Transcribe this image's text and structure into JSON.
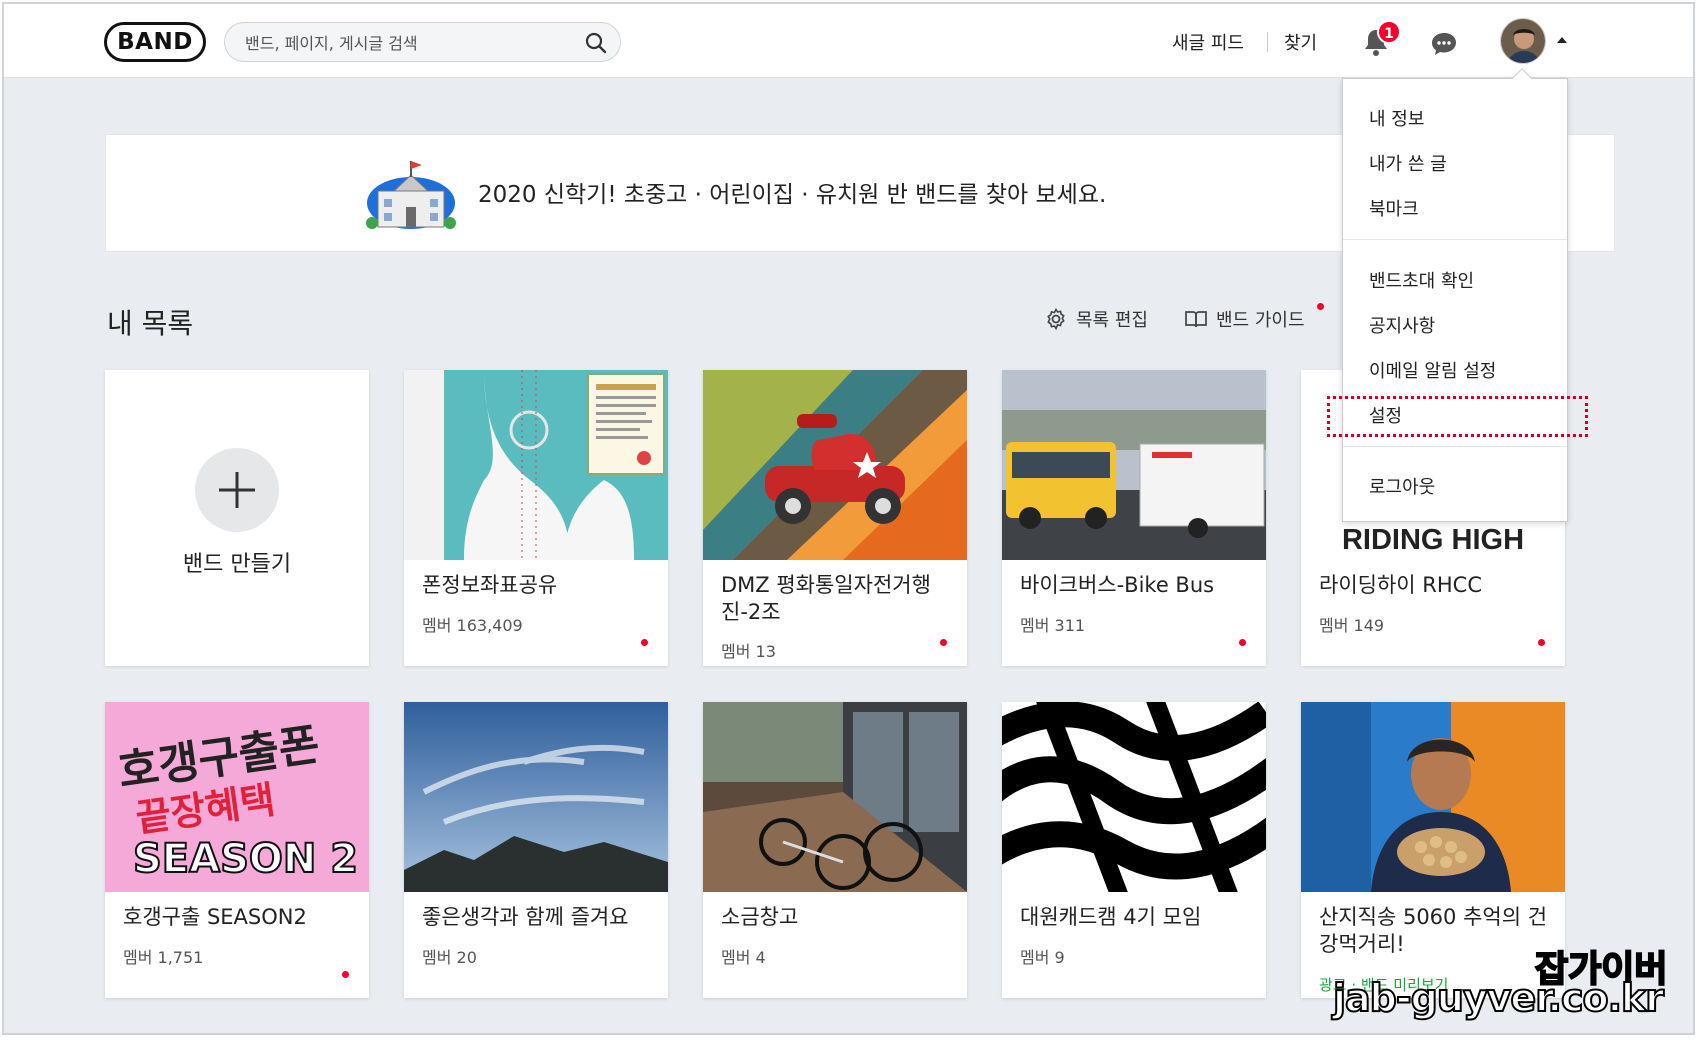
{
  "header": {
    "logo": "BAND",
    "search_placeholder": "밴드, 페이지, 게시글 검색",
    "new_feed": "새글 피드",
    "find": "찾기",
    "notification_count": "1"
  },
  "banner": {
    "text": "2020 신학기! 초중고 · 어린이집 · 유치원 반 밴드를 찾아 보세요."
  },
  "section": {
    "title": "내 목록",
    "edit_list": "목록 편집",
    "band_guide": "밴드 가이드"
  },
  "create_band": "밴드 만들기",
  "bands_row1": [
    {
      "name": "폰정보좌표공유",
      "members": "멤버 163,409"
    },
    {
      "name": "DMZ 평화통일자전거행진-2조",
      "members": "멤버 13"
    },
    {
      "name": "바이크버스-Bike Bus",
      "members": "멤버 311"
    },
    {
      "name": "라이딩하이 RHCC",
      "members": "멤버 149",
      "thumb_text": "RIDING HIGH"
    }
  ],
  "bands_row2": [
    {
      "name": "호갱구출 SEASON2",
      "members": "멤버 1,751",
      "thumb_lines": [
        "호갱구출폰",
        "끝장혜택",
        "SEASON 2"
      ]
    },
    {
      "name": "좋은생각과 함께 즐겨요",
      "members": "멤버 20"
    },
    {
      "name": "소금창고",
      "members": "멤버 4"
    },
    {
      "name": "대원캐드캠 4기 모임",
      "members": "멤버 9"
    },
    {
      "name": "산지직송 5060 추억의 건강먹거리!",
      "ad_label": "광고 · 밴드 미리보기"
    }
  ],
  "menu": {
    "items": [
      "내 정보",
      "내가 쓴 글",
      "북마크",
      "밴드초대 확인",
      "공지사항",
      "이메일 알림 설정",
      "설정",
      "로그아웃"
    ]
  },
  "watermark": {
    "line1": "잡가이버",
    "line2": "jab-guyver.co.kr"
  },
  "colors": {
    "accent_red": "#f2002b",
    "ad_green": "#1aa53a",
    "highlight_border": "#d0021b"
  }
}
